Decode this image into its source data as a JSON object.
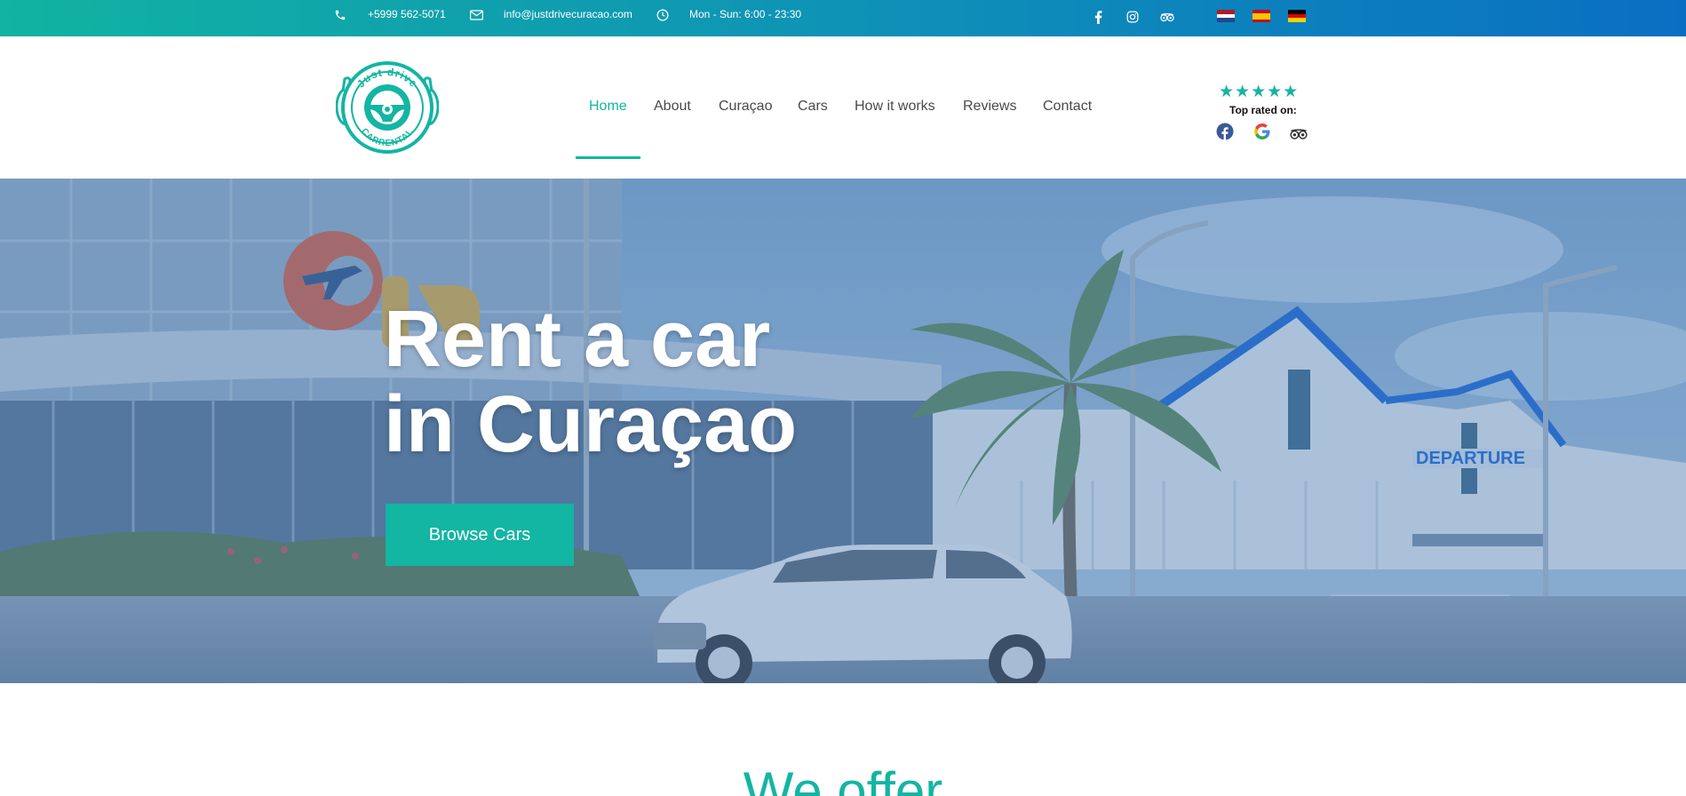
{
  "topbar": {
    "phone": "+5999 562-5071",
    "email": "info@justdrivecuracao.com",
    "hours": "Mon - Sun: 6:00 - 23:30",
    "icons": [
      "phone-icon",
      "envelope-icon",
      "clock-icon"
    ],
    "social": [
      "facebook-icon",
      "instagram-icon",
      "tripadvisor-icon"
    ],
    "languages": [
      "Dutch",
      "Spanish",
      "German"
    ]
  },
  "header": {
    "logo_text_top": "Just drive",
    "logo_text_bottom": "CARRENTAL",
    "nav": [
      {
        "label": "Home",
        "active": true
      },
      {
        "label": "About"
      },
      {
        "label": "Curaçao"
      },
      {
        "label": "Cars"
      },
      {
        "label": "How it works"
      },
      {
        "label": "Reviews"
      },
      {
        "label": "Contact"
      }
    ],
    "rating": {
      "stars": "★★★★★",
      "label": "Top rated on:",
      "platforms": [
        "facebook-icon",
        "google-icon",
        "tripadvisor-icon"
      ]
    }
  },
  "hero": {
    "title_line1": "Rent a car",
    "title_line2": "in Curaçao",
    "button": "Browse Cars",
    "background": "Curaçao International Airport terminal with white car and palm tree"
  },
  "sections": {
    "offer_title": "We offer"
  },
  "colors": {
    "accent": "#13b5a3",
    "topbar_start": "#11b3a1",
    "topbar_end": "#0a6fc2",
    "nav_text": "#4a4a4a"
  }
}
